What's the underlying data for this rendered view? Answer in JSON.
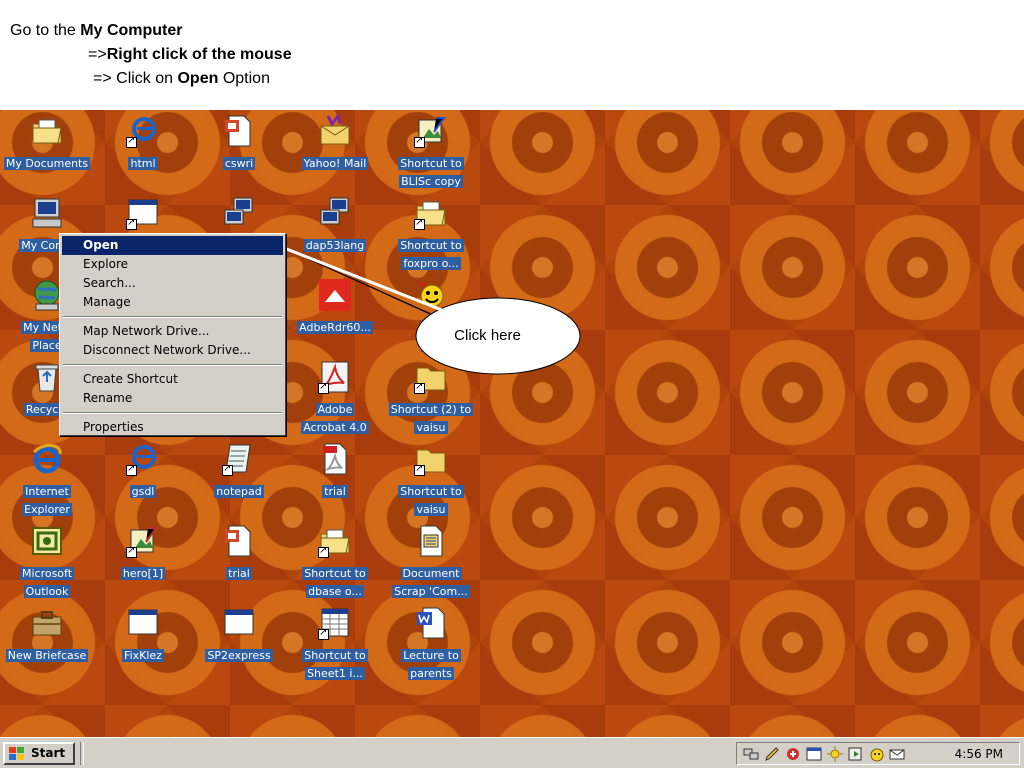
{
  "instructions": {
    "line1_prefix": "Go to the ",
    "line1_bold": "My Computer",
    "line2_prefix": "=>",
    "line2_bold": "Right click of the mouse",
    "line3_prefix": "=> Click on ",
    "line3_bold": "Open",
    "line3_suffix": " Option"
  },
  "desktop": {
    "icons": {
      "my_documents": "My Documents",
      "html": "html",
      "cswri": "cswri",
      "yahoo_mail": "Yahoo! Mail",
      "bliss_copy": "Shortcut to\nBLISc copy",
      "my_computer": "My Comp",
      "dap53lang": "dap53lang",
      "foxpro": "Shortcut to\nfoxpro o...",
      "network_places": "My Netw\nPlace",
      "adberdr": "AdbeRdr60...",
      "yahoo_messenger": "Yah\nMe",
      "recycle": "Recycle",
      "adobe_acrobat": "Adobe\nAcrobat 4.0",
      "shortcut2_vaisu": "Shortcut (2) to\nvaisu",
      "internet_explorer": "Internet\nExplorer",
      "gsdl": "gsdl",
      "notepad": "notepad",
      "trial_pdf": "trial",
      "shortcut_vaisu": "Shortcut to\nvaisu",
      "outlook": "Microsoft\nOutlook",
      "hero": "hero[1]",
      "trial_ppt": "trial",
      "dbase": "Shortcut to\ndbase o...",
      "doc_scrap": "Document\nScrap 'Com...",
      "briefcase": "New Briefcase",
      "fixklez": "FixKlez",
      "sp2express": "SP2express",
      "sheet1": "Shortcut to\nSheet1 i...",
      "lecture": "Lecture to\nparents"
    }
  },
  "context_menu": {
    "open": "Open",
    "explore": "Explore",
    "search": "Search...",
    "manage": "Manage",
    "map_drive": "Map Network Drive...",
    "disconnect_drive": "Disconnect Network Drive...",
    "create_shortcut": "Create Shortcut",
    "rename": "Rename",
    "properties": "Properties"
  },
  "callout": {
    "text": "Click here"
  },
  "taskbar": {
    "start_label": "Start",
    "clock": "4:56 PM"
  },
  "colors": {
    "desktop_bg": "#b0450c",
    "label_bg": "#2f5fa0",
    "menu_highlight": "#0a246a",
    "menu_bg": "#d4d0c8"
  }
}
